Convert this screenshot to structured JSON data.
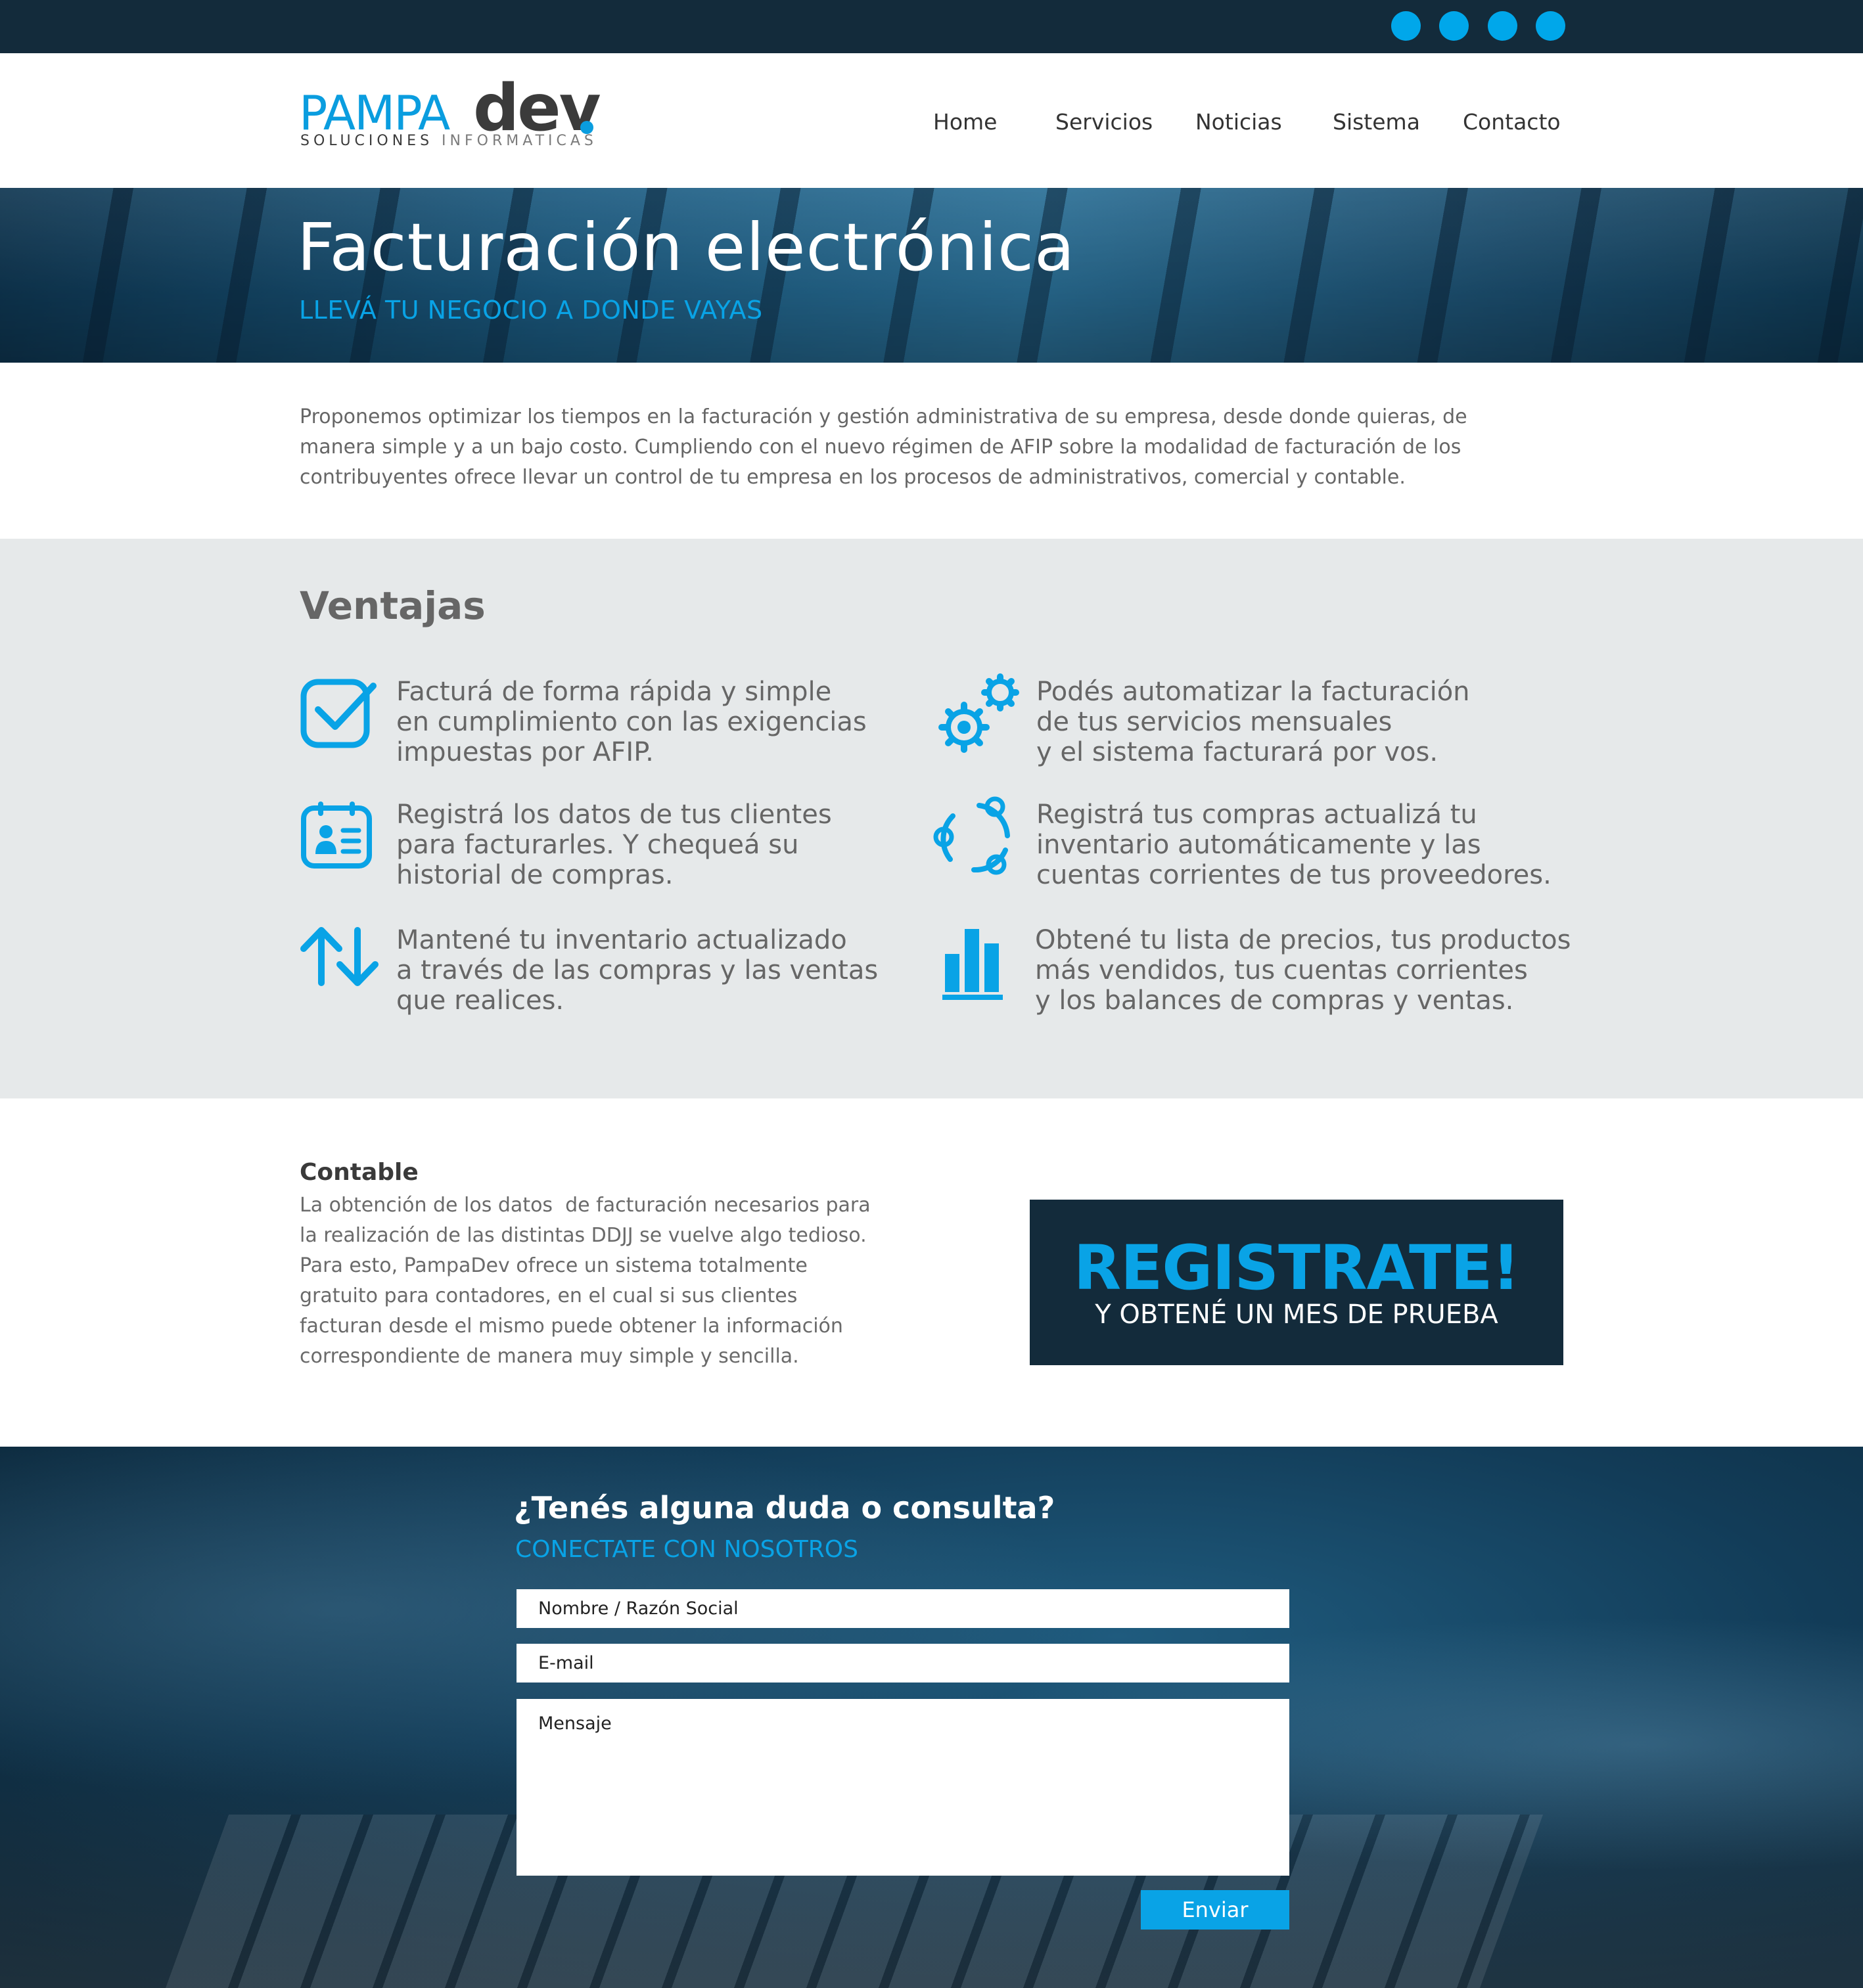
{
  "social": [
    {
      "icon": "social-icon-1"
    },
    {
      "icon": "social-icon-2"
    },
    {
      "icon": "social-icon-3"
    },
    {
      "icon": "social-icon-4"
    }
  ],
  "logo": {
    "brand_a": "PAMPA",
    "brand_b": "dev",
    "tagline_a": "SOLUCIONES",
    "tagline_b": "INFORMATICAS"
  },
  "nav": {
    "items": [
      {
        "label": "Home"
      },
      {
        "label": "Servicios"
      },
      {
        "label": "Noticias"
      },
      {
        "label": "Sistema"
      },
      {
        "label": "Contacto"
      }
    ]
  },
  "hero": {
    "title": "Facturación electrónica",
    "subtitle": "LLEVÁ TU NEGOCIO A DONDE VAYAS"
  },
  "intro": {
    "text": "Proponemos optimizar los tiempos en la facturación y gestión administrativa de su empresa, desde donde quieras, de manera simple y a un bajo costo. Cumpliendo con el nuevo régimen de AFIP sobre la modalidad de facturación de los contribuyentes ofrece llevar un control de tu empresa en los procesos de administrativos, comercial y contable."
  },
  "ventajas": {
    "title": "Ventajas",
    "items": [
      {
        "icon": "checkbox-icon",
        "text": "Facturá de forma rápida y simple\nen cumplimiento con las exigencias\nimpuestas por AFIP."
      },
      {
        "icon": "gears-icon",
        "text": "Podés automatizar la facturación\nde tus servicios mensuales\ny el sistema facturará por vos."
      },
      {
        "icon": "contact-card-icon",
        "text": "Registrá los datos de tus clientes\npara facturarles. Y chequeá su\nhistorial de compras."
      },
      {
        "icon": "cycle-icon",
        "text": "Registrá tus compras actualizá tu\ninventario automáticamente y las\ncuentas corrientes de tus proveedores."
      },
      {
        "icon": "up-down-arrows-icon",
        "text": "Mantené tu inventario actualizado\na través de las compras y las ventas\nque realices."
      },
      {
        "icon": "bar-chart-icon",
        "text": "Obtené tu lista de precios, tus productos\nmás vendidos, tus cuentas corrientes\ny los balances de compras y ventas."
      }
    ]
  },
  "contable": {
    "title": "Contable",
    "text": "La obtención de los datos  de facturación necesarios para\nla realización de las distintas DDJJ se vuelve algo tedioso.\nPara esto, PampaDev ofrece un sistema totalmente\ngratuito para contadores, en el cual si sus clientes\nfacturan desde el mismo puede obtener la información\ncorrespondiente de manera muy simple y sencilla."
  },
  "register": {
    "title": "REGISTRATE!",
    "subtitle": "Y OBTENÉ UN MES DE PRUEBA"
  },
  "contact": {
    "title": "¿Tenés alguna duda o consulta?",
    "subtitle": "CONECTATE CON NOSOTROS",
    "name_placeholder": "Nombre / Razón Social",
    "email_placeholder": "E-mail",
    "message_placeholder": "Mensaje",
    "send_label": "Enviar"
  },
  "colors": {
    "dark": "#132b3b",
    "accent": "#09a3e6",
    "light_gray": "#e6e9ea"
  }
}
